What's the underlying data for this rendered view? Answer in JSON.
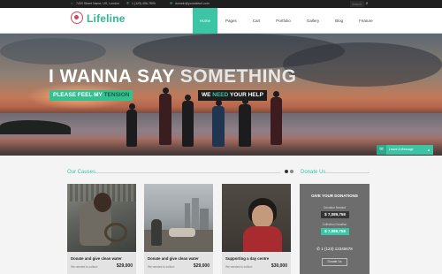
{
  "topbar": {
    "address": "7400 Street Name, US, London",
    "phone": "1 (123) 456-7890",
    "email": "domain@yoursiteurl.com",
    "search_placeholder": "Search",
    "search_icon": "search-icon"
  },
  "brand": {
    "name": "Lifeline"
  },
  "nav": {
    "items": [
      "Home",
      "Pages",
      "Cart",
      "Portfolio",
      "Gallery",
      "Blog",
      "Feature"
    ],
    "active_index": 0
  },
  "hero": {
    "title_part1": "I WANNA SAY ",
    "title_part2": "SOMETHING",
    "tag1_part1": "PLEASE FEEL MY ",
    "tag1_part2": "TENSION",
    "tag2_part1": "WE ",
    "tag2_part2": "NEED",
    "tag2_part3": " YOUR HELP"
  },
  "leave_message": {
    "label": "Leave A Message"
  },
  "causes": {
    "title": "Our Causes",
    "items": [
      {
        "title": "Donate and give clean water",
        "needed": "We needed to collect:",
        "amount": "$29,000"
      },
      {
        "title": "Donate and give clean water",
        "needed": "We needed to collect:",
        "amount": "$29,000"
      },
      {
        "title": "Supporting a day centre",
        "needed": "We needed to collect:",
        "amount": "$30,000"
      }
    ]
  },
  "donate": {
    "title": "Donate Us",
    "heading": "GIVE YOUR DONATIONS",
    "needed_label": "Donation Needed",
    "needed_value": "$ 7,089,758",
    "collected_label": "Collection Donation",
    "collected_value": "$ 7,089,758",
    "phone": "1 (123) 12345678",
    "button": "Donate Us"
  },
  "colors": {
    "accent": "#3bc5a4",
    "dark": "#1f1f1f",
    "brand_mark": "#c94b64"
  }
}
